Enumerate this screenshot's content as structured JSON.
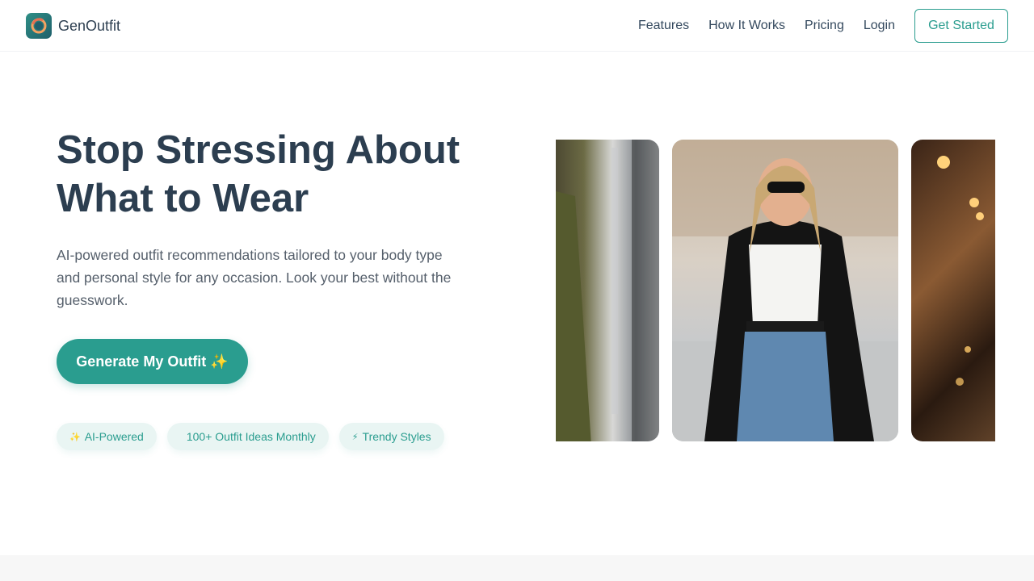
{
  "brand": {
    "name": "GenOutfit"
  },
  "nav": {
    "items": [
      "Features",
      "How It Works",
      "Pricing",
      "Login"
    ],
    "cta": "Get Started"
  },
  "hero": {
    "title": "Stop Stressing About What to Wear",
    "subtitle": "AI-powered outfit recommendations tailored to your body type and personal style for any occasion. Look your best without the guesswork.",
    "button": "Generate My Outfit ✨",
    "tags": [
      {
        "icon": "sparkle-icon",
        "glyph": "✨",
        "label": "AI-Powered"
      },
      {
        "icon": "",
        "glyph": "",
        "label": "100+ Outfit Ideas Monthly"
      },
      {
        "icon": "lightning-icon",
        "glyph": "⚡",
        "label": "Trendy Styles"
      }
    ]
  },
  "colors": {
    "accent": "#2a9d8f",
    "heading": "#2c3e50",
    "tag_bg": "#e9f5f3"
  }
}
